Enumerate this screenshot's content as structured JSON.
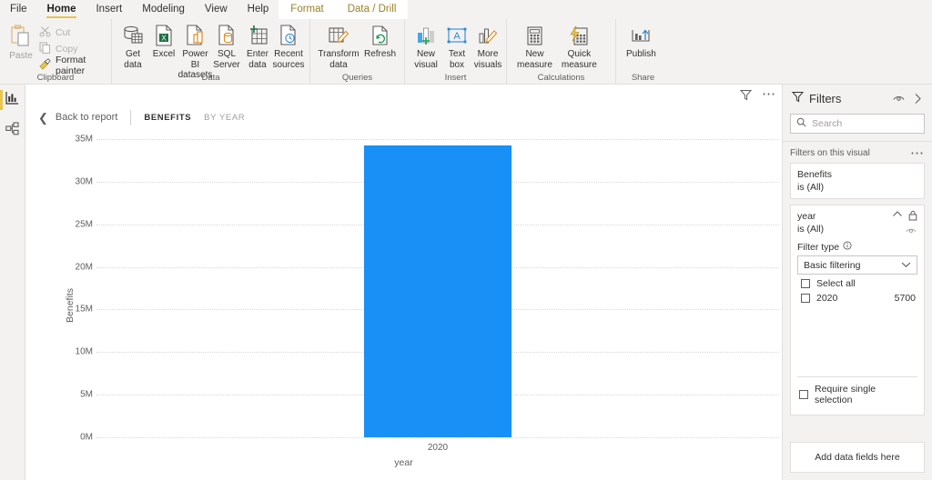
{
  "ribbon": {
    "tabs": [
      {
        "label": "File",
        "state": "normal"
      },
      {
        "label": "Home",
        "state": "active"
      },
      {
        "label": "Insert",
        "state": "normal"
      },
      {
        "label": "Modeling",
        "state": "normal"
      },
      {
        "label": "View",
        "state": "normal"
      },
      {
        "label": "Help",
        "state": "normal"
      },
      {
        "label": "Format",
        "state": "contextual"
      },
      {
        "label": "Data / Drill",
        "state": "contextual"
      }
    ],
    "groups": [
      {
        "name": "Clipboard",
        "paste": "Paste",
        "items": [
          {
            "label": "Cut",
            "icon": "scissors-icon",
            "disabled": true
          },
          {
            "label": "Copy",
            "icon": "copy-icon",
            "disabled": true
          },
          {
            "label": "Format painter",
            "icon": "paintbrush-icon",
            "disabled": false
          }
        ]
      },
      {
        "name": "Data",
        "items": [
          {
            "label": "Get\ndata",
            "icon": "database-icon",
            "caret": true
          },
          {
            "label": "Excel",
            "icon": "excel-icon",
            "caret": false
          },
          {
            "label": "Power BI\ndatasets",
            "icon": "powerbi-dataset-icon",
            "caret": false
          },
          {
            "label": "SQL\nServer",
            "icon": "sql-server-icon",
            "caret": false
          },
          {
            "label": "Enter\ndata",
            "icon": "enter-data-icon",
            "caret": false
          },
          {
            "label": "Recent\nsources",
            "icon": "recent-sources-icon",
            "caret": true
          }
        ]
      },
      {
        "name": "Queries",
        "items": [
          {
            "label": "Transform\ndata",
            "icon": "transform-data-icon",
            "caret": true
          },
          {
            "label": "Refresh",
            "icon": "refresh-icon",
            "caret": false
          }
        ]
      },
      {
        "name": "Insert",
        "items": [
          {
            "label": "New\nvisual",
            "icon": "new-visual-icon",
            "caret": false
          },
          {
            "label": "Text\nbox",
            "icon": "text-box-icon",
            "caret": false
          },
          {
            "label": "More\nvisuals",
            "icon": "more-visuals-icon",
            "caret": true
          }
        ]
      },
      {
        "name": "Calculations",
        "items": [
          {
            "label": "New\nmeasure",
            "icon": "new-measure-icon",
            "caret": false
          },
          {
            "label": "Quick\nmeasure",
            "icon": "quick-measure-icon",
            "caret": false
          }
        ]
      },
      {
        "name": "Share",
        "items": [
          {
            "label": "Publish",
            "icon": "publish-icon",
            "caret": false
          }
        ]
      }
    ]
  },
  "nav_rail": {
    "items": [
      {
        "name": "report-view",
        "icon": "report-bar-chart-icon",
        "selected": true
      },
      {
        "name": "model-view",
        "icon": "model-relationships-icon",
        "selected": false
      }
    ]
  },
  "visual": {
    "toolbar": {
      "filter_icon": "funnel-icon",
      "more_icon": "more-options-icon"
    },
    "drill_header": {
      "back_label": "Back to report",
      "back_icon": "chevron-left-icon",
      "crumbs": [
        {
          "label": "BENEFITS",
          "current": true
        },
        {
          "label": "BY YEAR",
          "current": false
        }
      ]
    }
  },
  "chart_data": {
    "type": "bar",
    "title": "",
    "categories": [
      "2020"
    ],
    "values": [
      34300000
    ],
    "value_labels": [
      ""
    ],
    "xlabel": "year",
    "ylabel": "Benefits",
    "ylim": [
      0,
      35000000
    ],
    "ytick_labels": [
      "35M",
      "30M",
      "25M",
      "20M",
      "15M",
      "10M",
      "5M",
      "0M"
    ],
    "ytick_values": [
      35000000,
      30000000,
      25000000,
      20000000,
      15000000,
      10000000,
      5000000,
      0
    ],
    "bar_color": "#1890f5",
    "grid": true,
    "grid_style": "dotted-horizontal",
    "legend": "none"
  },
  "filters_pane": {
    "title": "Filters",
    "filter_icon": "funnel-icon",
    "hide_icon": "eye-icon",
    "expand_icon": "chevron-right-icon",
    "search_placeholder": "Search",
    "search_icon": "search-icon",
    "section_title": "Filters on this visual",
    "section_more_icon": "more-options-icon",
    "cards": [
      {
        "name": "Benefits",
        "state": "is (All)",
        "expanded": false,
        "icons": []
      },
      {
        "name": "year",
        "state": "is (All)",
        "expanded": true,
        "icons": [
          "chevron-up-icon",
          "lock-icon",
          "eye-icon"
        ],
        "filter_type_label": "Filter type",
        "filter_type_info_icon": "info-icon",
        "filter_type_value": "Basic filtering",
        "filter_type_caret": "chevron-down-icon",
        "options": [
          {
            "label": "Select all",
            "count": "",
            "checked": false
          },
          {
            "label": "2020",
            "count": "5700",
            "checked": false
          }
        ],
        "require_single_selection": {
          "label": "Require single selection",
          "checked": false
        }
      }
    ],
    "dropzone_label": "Add data fields here"
  }
}
